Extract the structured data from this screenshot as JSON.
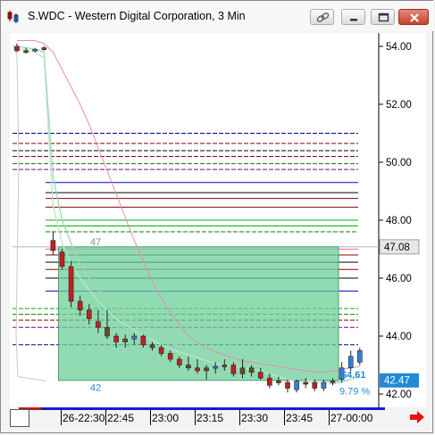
{
  "window": {
    "title": "S.WDC - Western Digital Corporation, 3 Min"
  },
  "titlebar_buttons": [
    {
      "name": "link-button",
      "icon": "link-icon"
    },
    {
      "name": "minimize-button",
      "icon": "minimize-icon"
    },
    {
      "name": "restore-button",
      "icon": "restore-icon"
    },
    {
      "name": "close-button",
      "icon": "close-icon"
    }
  ],
  "colors": {
    "up_candle": "#3a7fd6",
    "down_candle": "#c81e1e",
    "neutral_candle": "#6b4a2c",
    "box_fill": "#6ccf98",
    "price_marker_bg": "#2389d8",
    "last_box_bg": "#e6e6e6"
  },
  "price_axis": {
    "labels": [
      "54.00",
      "52.00",
      "50.00",
      "48.00",
      "46.00",
      "44.00",
      "42.00"
    ],
    "ylim": [
      41.8,
      54.6
    ]
  },
  "price_markers": {
    "upper_value": "47.08",
    "lower_value": "42.47"
  },
  "time_axis": {
    "labels": [
      "26-22:30",
      "22:45",
      "23:00",
      "23:15",
      "23:30",
      "23:45",
      "27-00:00"
    ]
  },
  "chart_annotations": {
    "box_top_label": "47",
    "box_bottom_label": "42",
    "change_value": "$4.61",
    "change_percent": "9.79 %"
  },
  "chart_data": {
    "type": "candlestick",
    "ylim": [
      41.8,
      54.6
    ],
    "candles": [
      {
        "o": 54.0,
        "h": 54.1,
        "l": 53.8,
        "c": 53.85,
        "dir": "down"
      },
      {
        "o": 53.85,
        "h": 53.95,
        "l": 53.75,
        "c": 53.8,
        "dir": "neutral"
      },
      {
        "o": 53.85,
        "h": 53.95,
        "l": 53.8,
        "c": 53.9,
        "dir": "up"
      },
      {
        "o": 53.95,
        "h": 54.0,
        "l": 53.85,
        "c": 53.9,
        "dir": "neutral"
      },
      {
        "o": 47.3,
        "h": 47.6,
        "l": 46.8,
        "c": 46.95,
        "dir": "down"
      },
      {
        "o": 46.9,
        "h": 47.0,
        "l": 46.3,
        "c": 46.4,
        "dir": "down"
      },
      {
        "o": 46.4,
        "h": 46.6,
        "l": 45.0,
        "c": 45.2,
        "dir": "down"
      },
      {
        "o": 45.2,
        "h": 45.4,
        "l": 44.7,
        "c": 44.9,
        "dir": "down"
      },
      {
        "o": 44.9,
        "h": 45.1,
        "l": 44.4,
        "c": 44.6,
        "dir": "down"
      },
      {
        "o": 44.5,
        "h": 44.9,
        "l": 44.1,
        "c": 44.3,
        "dir": "down"
      },
      {
        "o": 44.3,
        "h": 44.9,
        "l": 43.9,
        "c": 44.0,
        "dir": "neutral"
      },
      {
        "o": 44.0,
        "h": 44.1,
        "l": 43.6,
        "c": 43.8,
        "dir": "down"
      },
      {
        "o": 43.8,
        "h": 44.05,
        "l": 43.6,
        "c": 43.9,
        "dir": "neutral"
      },
      {
        "o": 43.9,
        "h": 44.1,
        "l": 43.7,
        "c": 44.0,
        "dir": "up"
      },
      {
        "o": 44.0,
        "h": 44.05,
        "l": 43.6,
        "c": 43.7,
        "dir": "down"
      },
      {
        "o": 43.7,
        "h": 43.8,
        "l": 43.5,
        "c": 43.6,
        "dir": "neutral"
      },
      {
        "o": 43.6,
        "h": 43.7,
        "l": 43.3,
        "c": 43.4,
        "dir": "down"
      },
      {
        "o": 43.4,
        "h": 43.5,
        "l": 43.1,
        "c": 43.2,
        "dir": "down"
      },
      {
        "o": 43.2,
        "h": 43.3,
        "l": 42.9,
        "c": 43.0,
        "dir": "down"
      },
      {
        "o": 43.0,
        "h": 43.3,
        "l": 42.8,
        "c": 42.9,
        "dir": "neutral"
      },
      {
        "o": 42.9,
        "h": 43.2,
        "l": 42.7,
        "c": 42.8,
        "dir": "down"
      },
      {
        "o": 42.8,
        "h": 43.0,
        "l": 42.5,
        "c": 42.9,
        "dir": "neutral"
      },
      {
        "o": 42.9,
        "h": 43.1,
        "l": 42.7,
        "c": 42.95,
        "dir": "up"
      },
      {
        "o": 42.95,
        "h": 43.2,
        "l": 42.8,
        "c": 43.0,
        "dir": "neutral"
      },
      {
        "o": 43.0,
        "h": 43.1,
        "l": 42.6,
        "c": 42.7,
        "dir": "down"
      },
      {
        "o": 42.7,
        "h": 43.2,
        "l": 42.55,
        "c": 42.9,
        "dir": "neutral"
      },
      {
        "o": 42.9,
        "h": 43.0,
        "l": 42.6,
        "c": 42.75,
        "dir": "neutral"
      },
      {
        "o": 42.75,
        "h": 42.9,
        "l": 42.5,
        "c": 42.55,
        "dir": "down"
      },
      {
        "o": 42.55,
        "h": 42.7,
        "l": 42.2,
        "c": 42.3,
        "dir": "down"
      },
      {
        "o": 42.4,
        "h": 42.6,
        "l": 42.3,
        "c": 42.45,
        "dir": "neutral"
      },
      {
        "o": 42.4,
        "h": 42.5,
        "l": 42.05,
        "c": 42.2,
        "dir": "down"
      },
      {
        "o": 42.15,
        "h": 42.5,
        "l": 42.05,
        "c": 42.45,
        "dir": "up"
      },
      {
        "o": 42.35,
        "h": 42.55,
        "l": 42.2,
        "c": 42.4,
        "dir": "neutral"
      },
      {
        "o": 42.4,
        "h": 42.5,
        "l": 42.1,
        "c": 42.2,
        "dir": "down"
      },
      {
        "o": 42.2,
        "h": 42.5,
        "l": 42.1,
        "c": 42.4,
        "dir": "up"
      },
      {
        "o": 42.4,
        "h": 42.55,
        "l": 42.3,
        "c": 42.45,
        "dir": "neutral"
      },
      {
        "o": 42.5,
        "h": 43.1,
        "l": 42.4,
        "c": 42.9,
        "dir": "up"
      },
      {
        "o": 42.9,
        "h": 43.5,
        "l": 42.8,
        "c": 43.3,
        "dir": "up"
      },
      {
        "o": 43.1,
        "h": 43.6,
        "l": 43.0,
        "c": 43.5,
        "dir": "up"
      }
    ],
    "box": {
      "from_index": 5,
      "to_index": 37,
      "top": 47.08,
      "bottom": 42.47
    },
    "h_levels": [
      {
        "y": 51.0,
        "color": "#00008b",
        "style": "dash"
      },
      {
        "y": 50.65,
        "color": "#8b0000",
        "style": "dash"
      },
      {
        "y": 50.4,
        "color": "#000000",
        "style": "dash"
      },
      {
        "y": 50.2,
        "color": "#8b0000",
        "style": "dash"
      },
      {
        "y": 49.95,
        "color": "#008000",
        "style": "dash"
      },
      {
        "y": 49.75,
        "color": "#800080",
        "style": "dash"
      },
      {
        "y": 49.3,
        "color": "#0000cd",
        "style": "solid"
      },
      {
        "y": 48.95,
        "color": "#000000",
        "style": "solid"
      },
      {
        "y": 48.75,
        "color": "#8b0000",
        "style": "solid"
      },
      {
        "y": 48.45,
        "color": "#8b0000",
        "style": "solid"
      },
      {
        "y": 48.0,
        "color": "#00b000",
        "style": "solid"
      },
      {
        "y": 47.8,
        "color": "#00b000",
        "style": "solid"
      },
      {
        "y": 47.6,
        "color": "#008000",
        "style": "dash"
      },
      {
        "y": 47.0,
        "color": "#ff69b4",
        "style": "solid"
      },
      {
        "y": 46.8,
        "color": "#8b0000",
        "style": "solid"
      },
      {
        "y": 46.55,
        "color": "#000000",
        "style": "solid"
      },
      {
        "y": 46.3,
        "color": "#8b0000",
        "style": "solid"
      },
      {
        "y": 46.0,
        "color": "#000000",
        "style": "solid"
      },
      {
        "y": 45.55,
        "color": "#0000cd",
        "style": "solid"
      },
      {
        "y": 44.95,
        "color": "#00b000",
        "style": "dash"
      },
      {
        "y": 44.75,
        "color": "#008000",
        "style": "dash"
      },
      {
        "y": 44.55,
        "color": "#8b0000",
        "style": "dash"
      },
      {
        "y": 44.3,
        "color": "#800080",
        "style": "dash"
      },
      {
        "y": 43.7,
        "color": "#00008b",
        "style": "dash"
      }
    ],
    "ma_green": [
      53.9,
      53.9,
      53.8,
      53.6,
      48.5,
      47.2,
      46.5,
      46.0,
      45.6,
      45.2,
      44.9,
      44.6,
      44.4,
      44.2,
      44.0,
      43.85,
      43.7,
      43.55,
      43.45,
      43.35,
      43.25,
      43.15,
      43.05,
      43.0,
      42.95,
      42.9,
      42.85,
      42.8,
      42.7,
      42.6,
      42.5,
      42.45,
      42.4,
      42.4,
      42.35,
      42.35,
      42.4,
      42.5,
      42.6
    ],
    "ma_green2": [
      54.0,
      53.95,
      53.9,
      53.8,
      49.5,
      48.0,
      47.2,
      46.5,
      46.0,
      45.6,
      45.3,
      45.0,
      44.75,
      44.5,
      44.3,
      44.1,
      43.95,
      43.8,
      43.65,
      43.55,
      43.45,
      43.35,
      43.25,
      43.15,
      43.1,
      43.05,
      43.0,
      42.95,
      42.85,
      42.75,
      42.65,
      42.55,
      42.5,
      42.45,
      42.45,
      42.4,
      42.45,
      42.5,
      42.6
    ],
    "ma_pink": [
      54.2,
      54.2,
      54.2,
      54.1,
      53.8,
      53.2,
      52.6,
      52.0,
      51.3,
      50.5,
      49.7,
      48.9,
      48.1,
      47.3,
      46.6,
      45.9,
      45.3,
      44.8,
      44.4,
      44.0,
      43.8,
      43.6,
      43.45,
      43.35,
      43.25,
      43.15,
      43.1,
      43.05,
      43.0,
      42.95,
      42.9,
      42.85,
      42.8,
      42.75,
      42.75,
      42.8,
      42.85,
      42.9,
      42.95
    ],
    "current_line": 47.08
  }
}
